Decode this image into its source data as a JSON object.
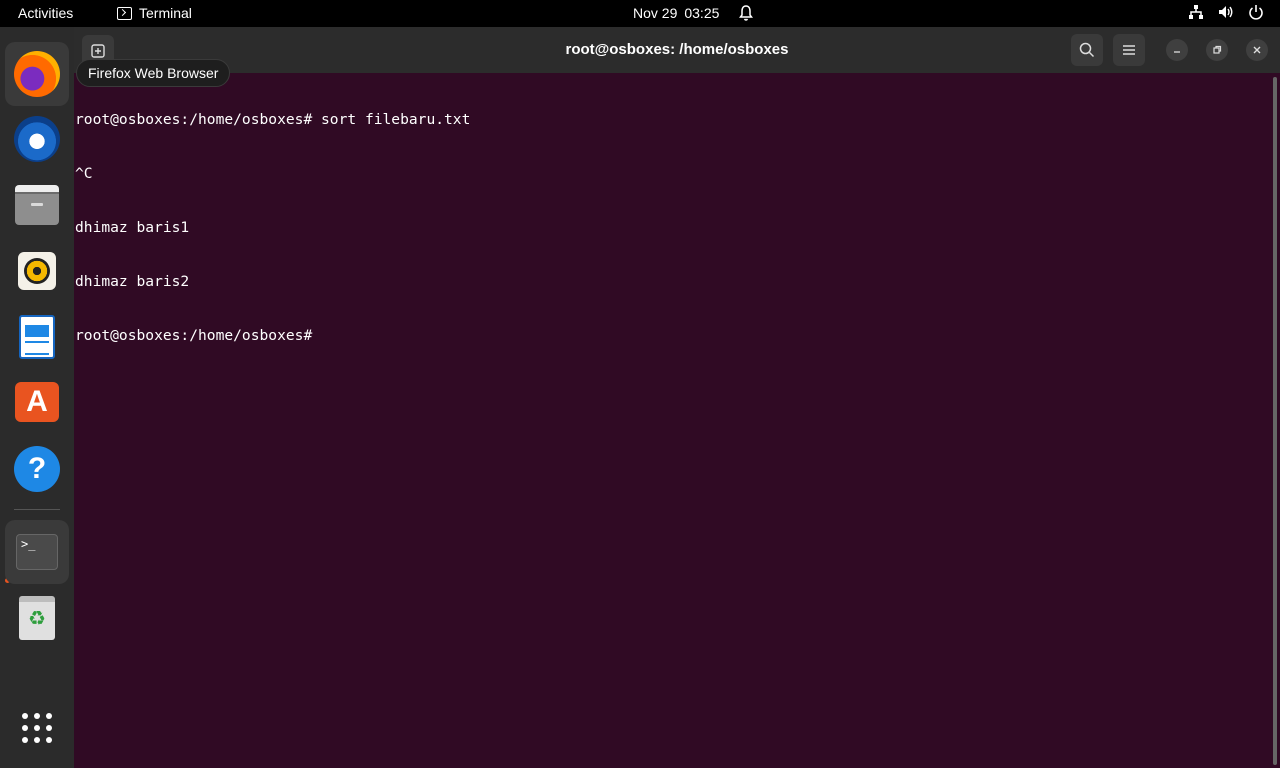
{
  "topbar": {
    "activities": "Activities",
    "app_name": "Terminal",
    "date": "Nov 29",
    "time": "03:25"
  },
  "dock": {
    "tooltip": "Firefox Web Browser",
    "items": [
      "firefox-icon",
      "thunderbird-icon",
      "files-icon",
      "rhythmbox-icon",
      "libreoffice-writer-icon",
      "app-center-icon",
      "help-icon",
      "terminal-icon",
      "trash-icon",
      "show-apps-icon"
    ],
    "active_item": "terminal-icon",
    "accent": "#e95420"
  },
  "window": {
    "title": "root@osboxes: /home/osboxes"
  },
  "terminal": {
    "background": "#300a24",
    "lines": [
      "root@osboxes:/home/osboxes# sort filebaru.txt",
      "^C",
      "dhimaz baris1",
      "dhimaz baris2",
      "root@osboxes:/home/osboxes#"
    ]
  }
}
